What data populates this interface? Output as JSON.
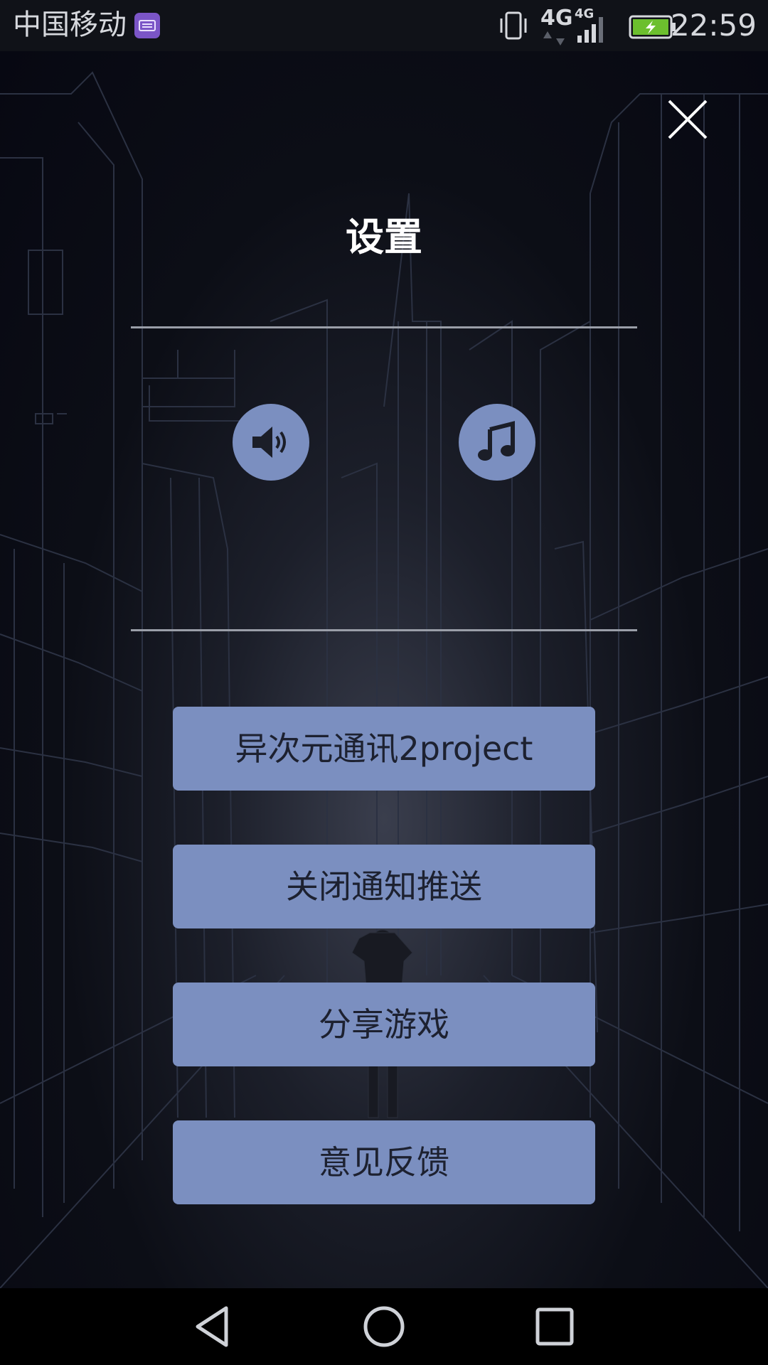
{
  "status_bar": {
    "carrier": "中国移动",
    "network_1": "4G",
    "network_2": "4G",
    "time": "22:59",
    "icons": [
      "keyboard-icon",
      "vibrate-icon",
      "data-transfer-icon",
      "signal-icon",
      "battery-charging-icon"
    ],
    "battery_color": "#6cbf2e"
  },
  "settings": {
    "title": "设置",
    "close_icon": "close-icon",
    "sound_icon": "speaker-icon",
    "music_icon": "music-note-icon",
    "buttons": [
      {
        "label": "异次元通讯2project"
      },
      {
        "label": "关闭通知推送"
      },
      {
        "label": "分享游戏"
      },
      {
        "label": "意见反馈"
      }
    ]
  },
  "nav_bar": {
    "icons": [
      "back-triangle-icon",
      "home-circle-icon",
      "recent-apps-square-icon"
    ]
  },
  "colors": {
    "button_fill": "#7b8fc0",
    "background": "#0c0e16",
    "title_text": "#ffffff"
  }
}
